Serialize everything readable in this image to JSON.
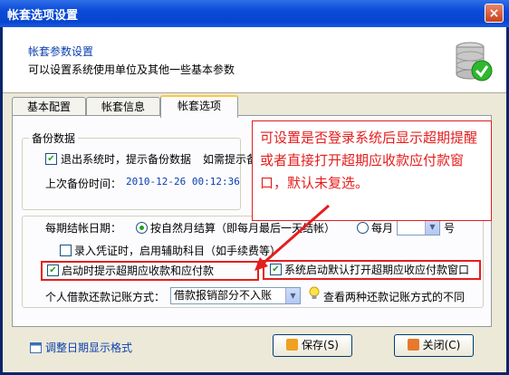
{
  "window": {
    "title": "帐套选项设置",
    "close": "×"
  },
  "header": {
    "title": "帐套参数设置",
    "subtitle": "可以设置系统使用单位及其他一些基本参数",
    "icon": "database-check-icon"
  },
  "tabs": [
    {
      "label": "基本配置",
      "active": false
    },
    {
      "label": "帐套信息",
      "active": false
    },
    {
      "label": "帐套选项",
      "active": true
    }
  ],
  "backup": {
    "group_label": "备份数据",
    "exit_prompt_label": "退出系统时，提示备份数据",
    "exit_prompt_checked": true,
    "extra_label": "如需提示备",
    "last_backup_label": "上次备份时间：",
    "last_backup_value": "2010-12-26 00:12:36"
  },
  "settings": {
    "period_label": "每期结帐日期：",
    "natural_month_label": "按自然月结算（即每月最后一天结帐）",
    "natural_month_selected": true,
    "monthly_label": "每月",
    "monthly_selected": false,
    "monthly_value": "",
    "day_suffix": "号",
    "aux_subject_label": "录入凭证时，启用辅助科目（如手续费等）",
    "aux_subject_checked": false,
    "overdue_prompt_label": "启动时提示超期应收款和应付款",
    "overdue_prompt_checked": true,
    "open_overdue_label": "系统启动默认打开超期应收应付款窗口",
    "open_overdue_checked": true,
    "loan_label": "个人借款还款记账方式：",
    "loan_value": "借款报销部分不入账",
    "loan_hint": "查看两种还款记账方式的不同"
  },
  "callout": {
    "text": "可设置是否登录系统后显示超期提醒或者直接打开超期应收款应付款窗口，默认未复选。"
  },
  "footer": {
    "date_format_label": "调整日期显示格式",
    "save_label": "保存(S)",
    "close_label": "关闭(C)"
  },
  "colors": {
    "accent": "#0a3fae",
    "highlight": "#e51e1e",
    "check": "#21a121"
  }
}
